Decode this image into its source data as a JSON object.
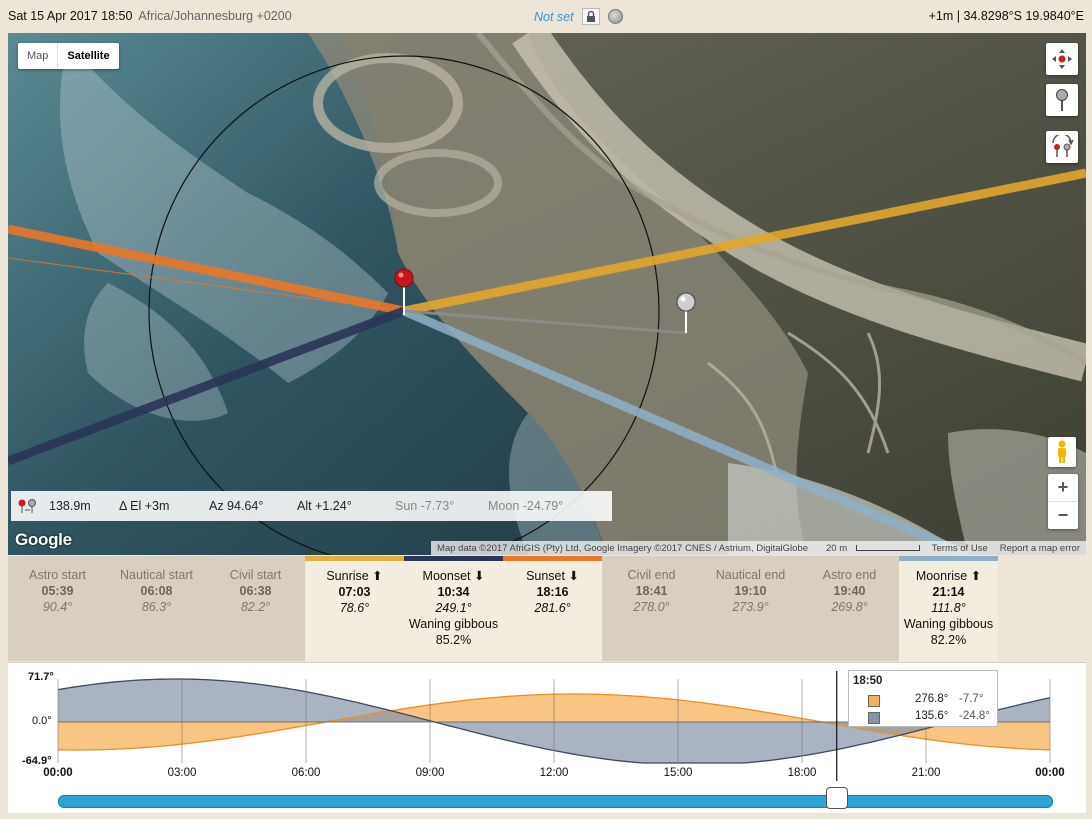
{
  "topbar": {
    "datetime": "Sat 15 Apr 2017 18:50",
    "timezone": "Africa/Johannesburg +0200",
    "status": "Not set",
    "location": "+1m | 34.8298°S 19.9840°E"
  },
  "map": {
    "type_map": "Map",
    "type_satellite": "Satellite",
    "info": {
      "distance": "138.9m",
      "delta_el": "Δ El  +3m",
      "azimuth": "Az 94.64°",
      "altitude": "Alt  +1.24°",
      "sun": "Sun -7.73°",
      "moon": "Moon -24.79°"
    },
    "google": "Google",
    "attribution": "Map data ©2017 AfriGIS (Pty) Ltd, Google Imagery ©2017 CNES / Astrium, DigitalGlobe",
    "scale": "20 m",
    "terms": "Terms of Use",
    "report": "Report a map error",
    "zoom_in": "+",
    "zoom_out": "−",
    "colors": {
      "sunrise_line": "#e2a72e",
      "sunset_line": "#e8772a",
      "moonset_line": "#2a3558",
      "moonrise_line": "#8fb1c8"
    }
  },
  "events": [
    {
      "name": "Astro start",
      "time": "05:39",
      "az": "90.4°",
      "phase": "",
      "pct": "",
      "lit": false
    },
    {
      "name": "Nautical start",
      "time": "06:08",
      "az": "86.3°",
      "phase": "",
      "pct": "",
      "lit": false
    },
    {
      "name": "Civil start",
      "time": "06:38",
      "az": "82.2°",
      "phase": "",
      "pct": "",
      "lit": false
    },
    {
      "name": "Sunrise ⬆",
      "time": "07:03",
      "az": "78.6°",
      "phase": "",
      "pct": "",
      "lit": true,
      "color": "#e2b040"
    },
    {
      "name": "Moonset ⬇",
      "time": "10:34",
      "az": "249.1°",
      "phase": "Waning gibbous",
      "pct": "85.2%",
      "lit": true,
      "color": "#2a3558"
    },
    {
      "name": "Sunset ⬇",
      "time": "18:16",
      "az": "281.6°",
      "phase": "",
      "pct": "",
      "lit": true,
      "color": "#e8772a"
    },
    {
      "name": "Civil end",
      "time": "18:41",
      "az": "278.0°",
      "phase": "",
      "pct": "",
      "lit": false
    },
    {
      "name": "Nautical end",
      "time": "19:10",
      "az": "273.9°",
      "phase": "",
      "pct": "",
      "lit": false
    },
    {
      "name": "Astro end",
      "time": "19:40",
      "az": "269.8°",
      "phase": "",
      "pct": "",
      "lit": false
    },
    {
      "name": "Moonrise ⬆",
      "time": "21:14",
      "az": "111.8°",
      "phase": "Waning gibbous",
      "pct": "82.2%",
      "lit": true,
      "color": "#8fb1c8"
    }
  ],
  "chart": {
    "ymax": "71.7°",
    "yzero": "0.0°",
    "ymin": "-64.9°",
    "xlabels": [
      "00:00",
      "03:00",
      "06:00",
      "09:00",
      "12:00",
      "15:00",
      "18:00",
      "21:00",
      "00:00"
    ],
    "legend": {
      "time": "18:50",
      "sun_az": "276.8°",
      "sun_el": "-7.7°",
      "moon_az": "135.6°",
      "moon_el": "-24.8°",
      "sun_color": "#f5b25c",
      "moon_color": "#8593a6"
    },
    "current_time_fraction": 0.785
  }
}
